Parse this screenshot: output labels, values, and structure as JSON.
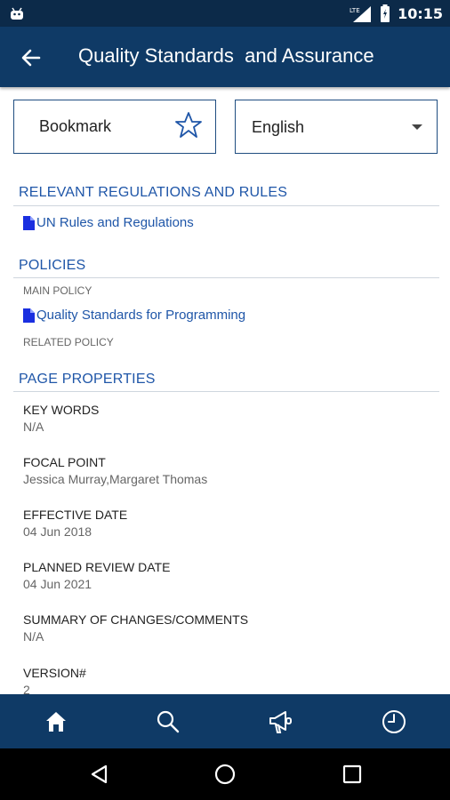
{
  "status_bar": {
    "time": "10:15",
    "network_label": "LTE"
  },
  "app_bar": {
    "title": "Quality Standards  and Assurance"
  },
  "controls": {
    "bookmark_label": "Bookmark",
    "language_selected": "English"
  },
  "sections": {
    "regulations": {
      "header": "RELEVANT REGULATIONS AND RULES",
      "link": "UN Rules and Regulations"
    },
    "policies": {
      "header": "POLICIES",
      "main_label": "MAIN POLICY",
      "main_link": "Quality Standards for Programming",
      "related_label": "RELATED POLICY"
    },
    "properties": {
      "header": "PAGE PROPERTIES",
      "items": [
        {
          "key": "KEY WORDS",
          "value": "N/A"
        },
        {
          "key": "FOCAL POINT",
          "value": "Jessica Murray,Margaret Thomas"
        },
        {
          "key": "EFFECTIVE DATE",
          "value": "04 Jun 2018"
        },
        {
          "key": "PLANNED REVIEW DATE",
          "value": "04 Jun 2021"
        },
        {
          "key": "SUMMARY OF CHANGES/COMMENTS",
          "value": "N/A"
        },
        {
          "key": "VERSION#",
          "value": "2"
        }
      ]
    }
  },
  "bottom_nav": {
    "tabs": [
      "home-icon",
      "search-icon",
      "megaphone-icon",
      "clock-icon"
    ]
  },
  "colors": {
    "app_bar": "#0f3a66",
    "status_bar": "#0c2a49",
    "accent": "#1f56a8"
  }
}
